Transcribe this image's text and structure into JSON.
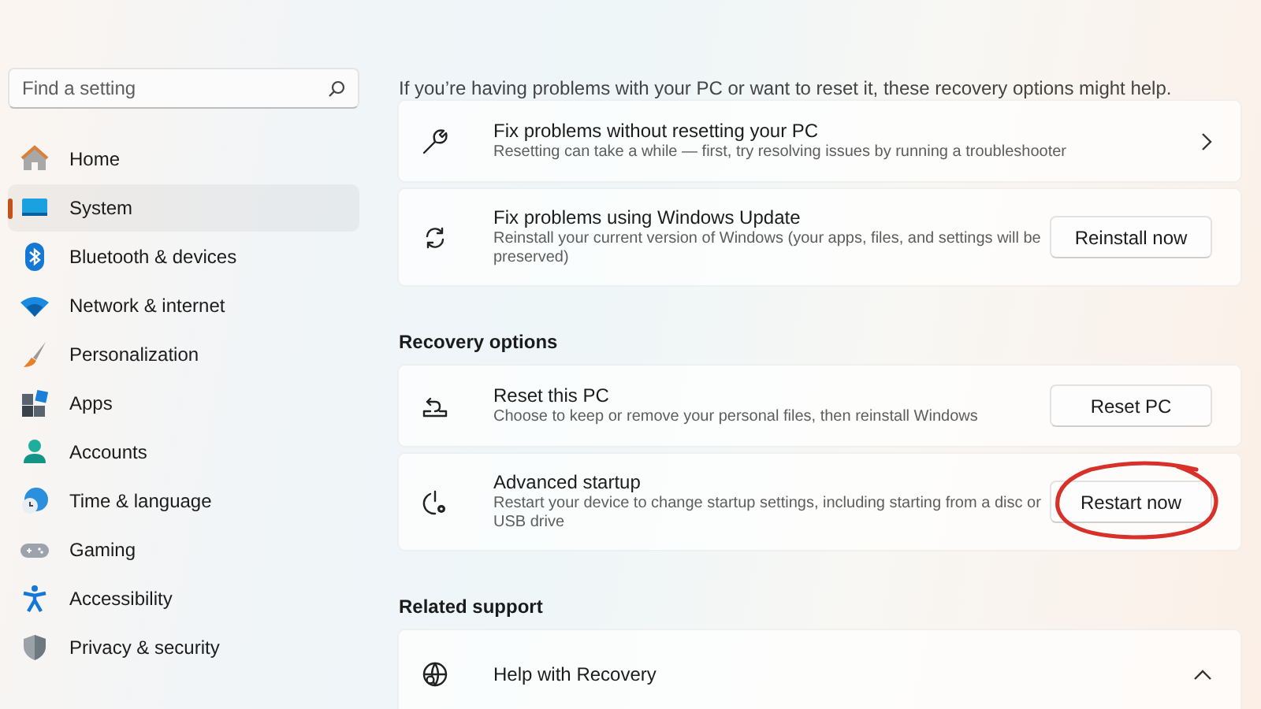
{
  "search": {
    "placeholder": "Find a setting"
  },
  "nav": [
    {
      "label": "Home",
      "selected": false
    },
    {
      "label": "System",
      "selected": true
    },
    {
      "label": "Bluetooth & devices",
      "selected": false
    },
    {
      "label": "Network & internet",
      "selected": false
    },
    {
      "label": "Personalization",
      "selected": false
    },
    {
      "label": "Apps",
      "selected": false
    },
    {
      "label": "Accounts",
      "selected": false
    },
    {
      "label": "Time & language",
      "selected": false
    },
    {
      "label": "Gaming",
      "selected": false
    },
    {
      "label": "Accessibility",
      "selected": false
    },
    {
      "label": "Privacy & security",
      "selected": false
    }
  ],
  "description": "If you’re having problems with your PC or want to reset it, these recovery options might help.",
  "sections": [
    {
      "cards": [
        {
          "title": "Fix problems without resetting your PC",
          "subtitle": "Resetting can take a while — first, try resolving issues by running a troubleshooter",
          "action": {
            "kind": "chevron"
          }
        },
        {
          "title": "Fix problems using Windows Update",
          "subtitle": "Reinstall your current version of Windows (your apps, files, and settings will be preserved)",
          "action": {
            "kind": "button",
            "label": "Reinstall now",
            "circled": false
          }
        }
      ]
    },
    {
      "heading": "Recovery options",
      "cards": [
        {
          "title": "Reset this PC",
          "subtitle": "Choose to keep or remove your personal files, then reinstall Windows",
          "action": {
            "kind": "button",
            "label": "Reset PC",
            "circled": false
          }
        },
        {
          "title": "Advanced startup",
          "subtitle": "Restart your device to change startup settings, including starting from a disc or USB drive",
          "action": {
            "kind": "button",
            "label": "Restart now",
            "circled": true
          }
        }
      ]
    },
    {
      "heading": "Related support",
      "cards": [
        {
          "title": "Help with Recovery",
          "action": {
            "kind": "expander",
            "expanded": true
          }
        }
      ]
    }
  ]
}
